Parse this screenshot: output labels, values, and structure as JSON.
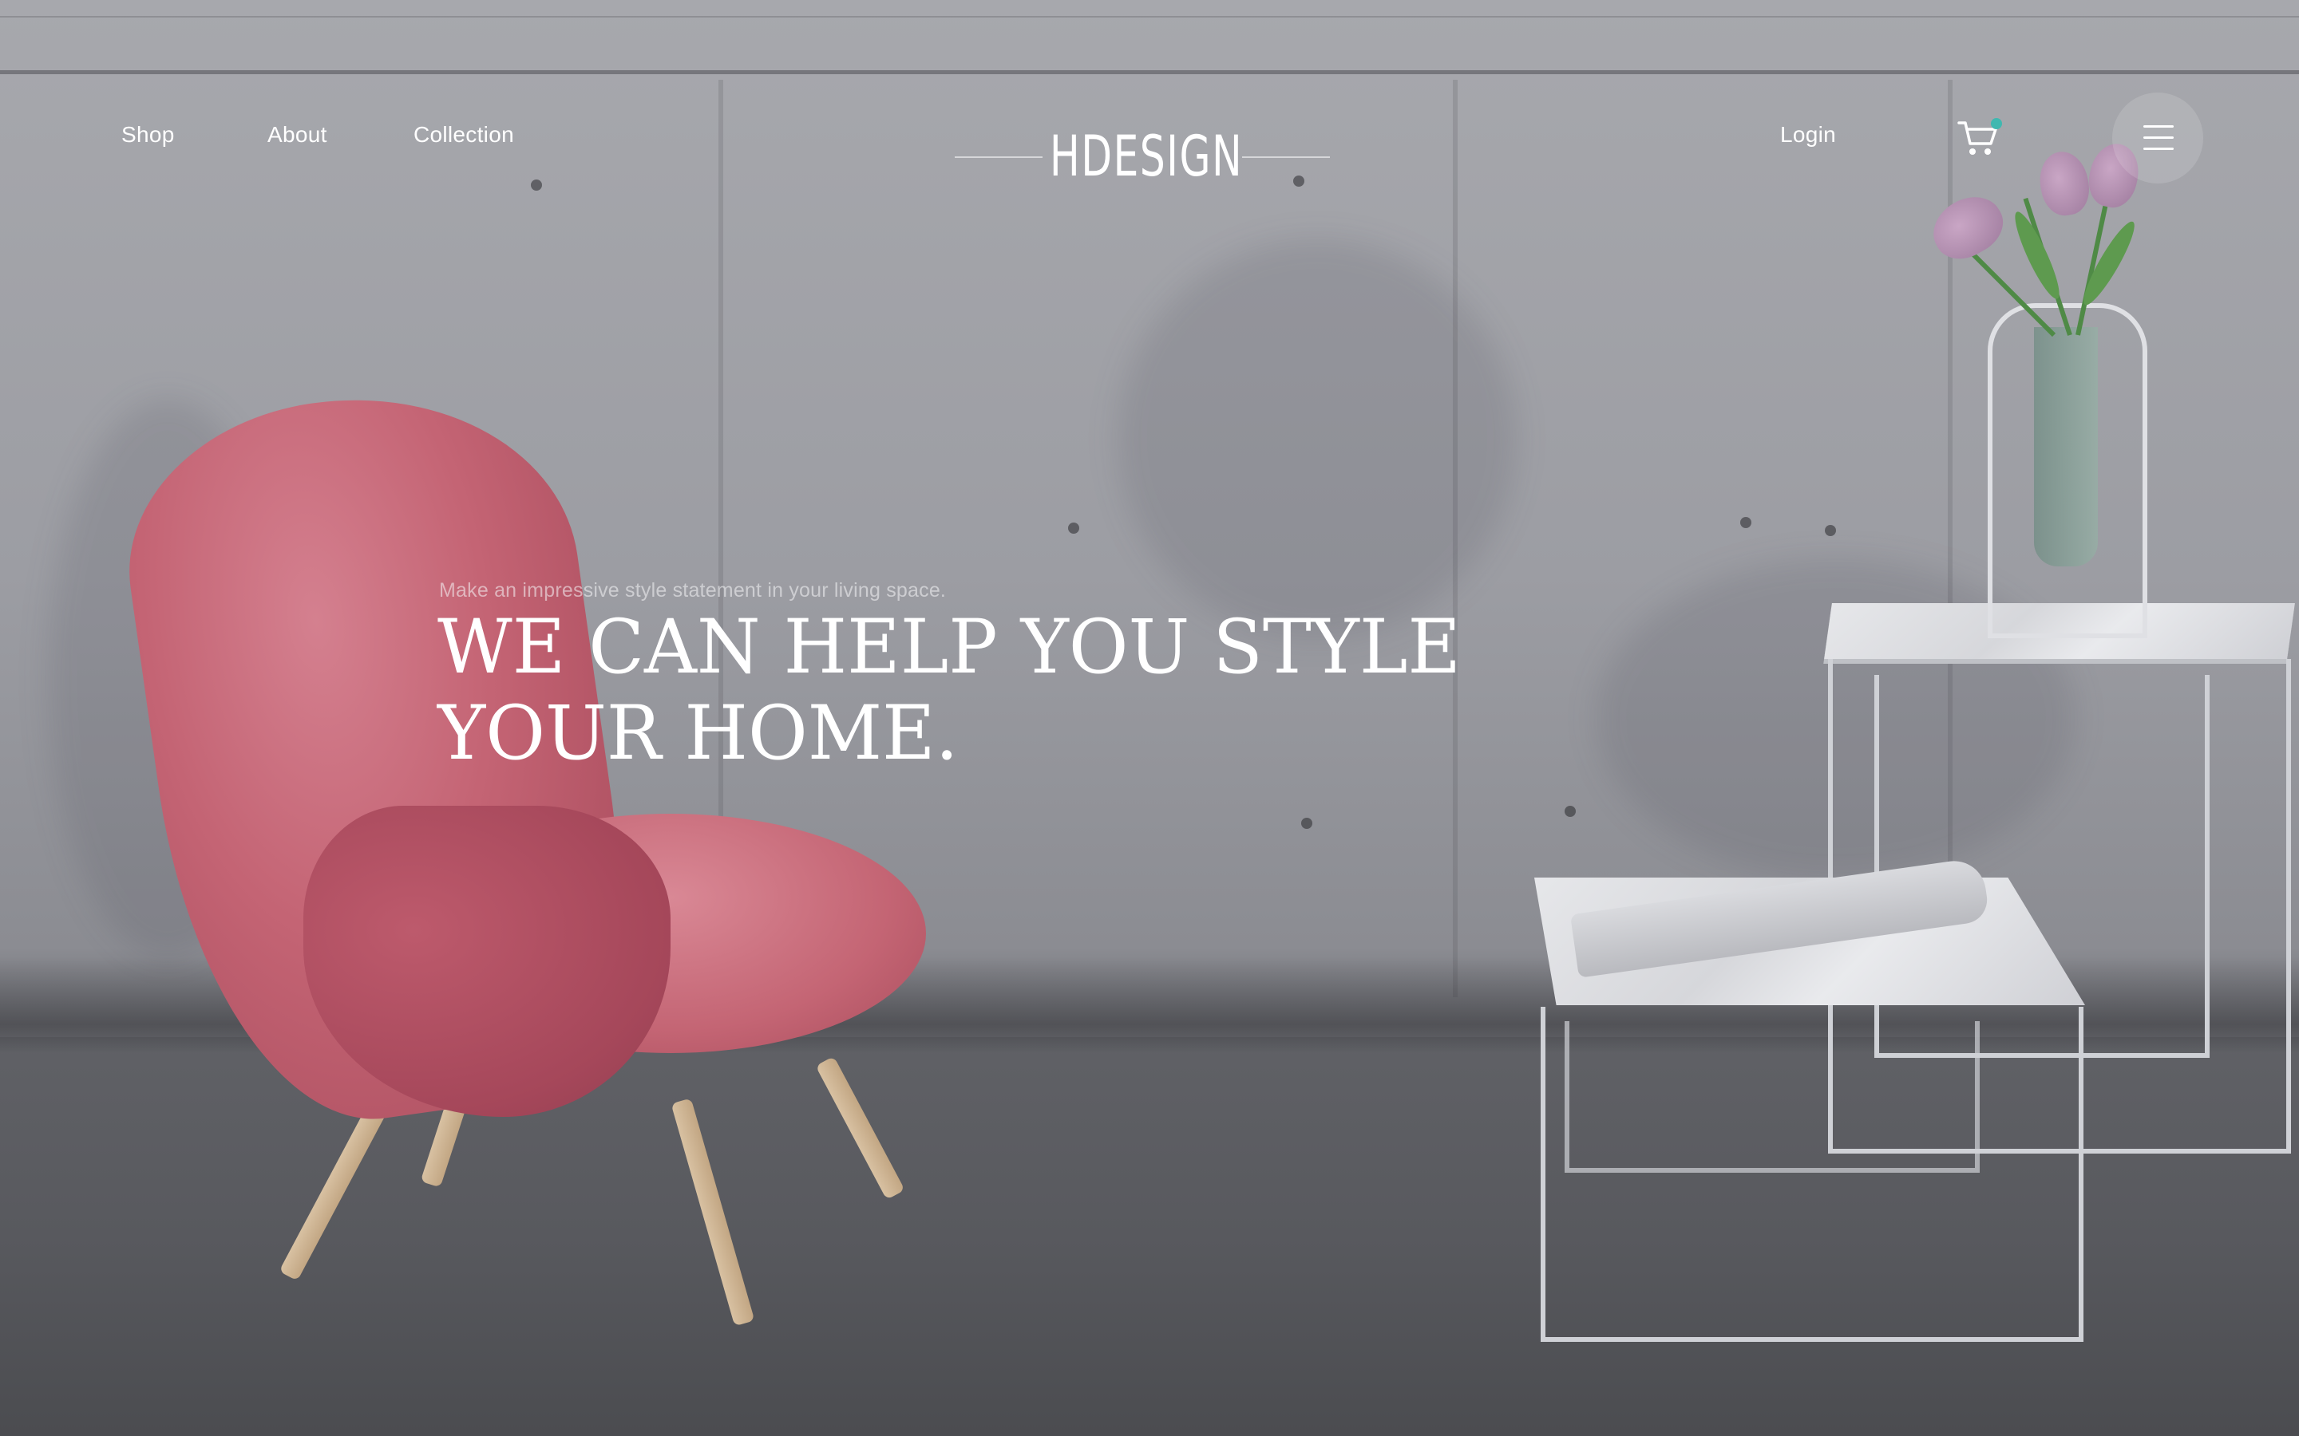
{
  "nav": {
    "left_links": [
      {
        "label": "Shop"
      },
      {
        "label": "About"
      },
      {
        "label": "Collection"
      }
    ],
    "logo_text": "HDESIGN",
    "login_label": "Login",
    "cart_icon": "cart-icon",
    "cart_badge_color": "#3fb8b0",
    "menu_icon": "hamburger-menu-icon"
  },
  "hero": {
    "tagline": "Make an impressive style statement in your living space.",
    "headline_line1": "We can help you style",
    "headline_line2": "your home."
  },
  "colors": {
    "text": "#ffffff",
    "chair": "#c46474",
    "wall": "#a0a1a7"
  }
}
